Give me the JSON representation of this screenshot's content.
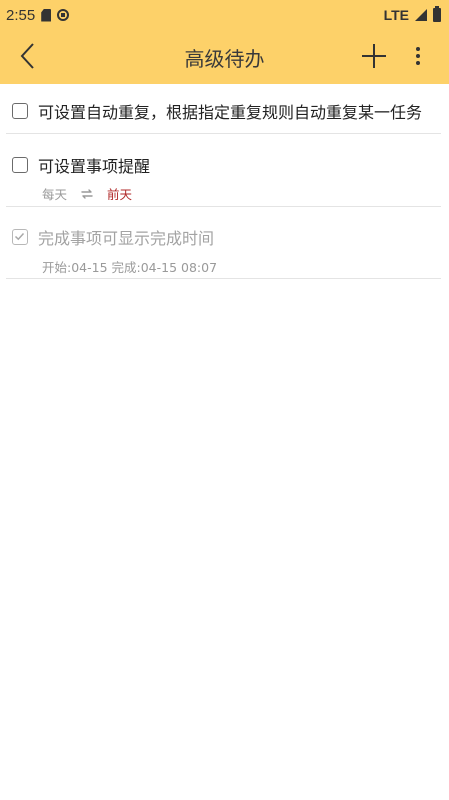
{
  "status_bar": {
    "time": "2:55",
    "network": "LTE"
  },
  "app_bar": {
    "title": "高级待办",
    "back_icon": "chevron-left-icon",
    "add_icon": "plus-icon",
    "more_icon": "more-vert-icon"
  },
  "tasks": [
    {
      "title": "可设置自动重复，根据指定重复规则自动重复某一任务",
      "checked": false
    },
    {
      "title": "可设置事项提醒",
      "checked": false,
      "repeat": "每天",
      "reminder": "前天"
    },
    {
      "title": "完成事项可显示完成时间",
      "checked": true,
      "times": "开始:04-15 完成:04-15 08:07"
    }
  ],
  "colors": {
    "header": "#fdd169",
    "reminder": "#b02a2a"
  }
}
